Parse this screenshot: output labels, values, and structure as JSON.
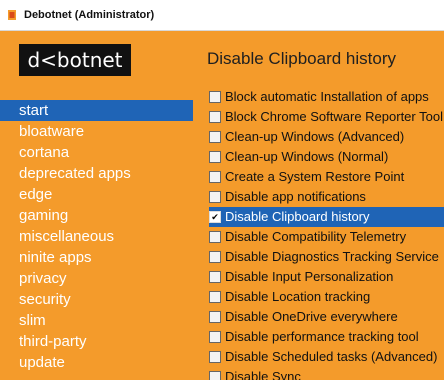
{
  "window": {
    "title": "Debotnet (Administrator)"
  },
  "sidebar": {
    "logo": "d<botnet",
    "items": [
      {
        "label": "start",
        "selected": true
      },
      {
        "label": "bloatware",
        "selected": false
      },
      {
        "label": "cortana",
        "selected": false
      },
      {
        "label": "deprecated apps",
        "selected": false
      },
      {
        "label": "edge",
        "selected": false
      },
      {
        "label": "gaming",
        "selected": false
      },
      {
        "label": "miscellaneous",
        "selected": false
      },
      {
        "label": "ninite apps",
        "selected": false
      },
      {
        "label": "privacy",
        "selected": false
      },
      {
        "label": "security",
        "selected": false
      },
      {
        "label": "slim",
        "selected": false
      },
      {
        "label": "third-party",
        "selected": false
      },
      {
        "label": "update",
        "selected": false
      }
    ]
  },
  "main": {
    "title": "Disable Clipboard history",
    "options": [
      {
        "label": "Block automatic Installation of apps",
        "checked": false,
        "selected": false
      },
      {
        "label": "Block Chrome Software Reporter Tool",
        "checked": false,
        "selected": false
      },
      {
        "label": "Clean-up Windows (Advanced)",
        "checked": false,
        "selected": false
      },
      {
        "label": "Clean-up Windows (Normal)",
        "checked": false,
        "selected": false
      },
      {
        "label": "Create a System Restore Point",
        "checked": false,
        "selected": false
      },
      {
        "label": "Disable app notifications",
        "checked": false,
        "selected": false
      },
      {
        "label": "Disable Clipboard history",
        "checked": true,
        "selected": true
      },
      {
        "label": "Disable Compatibility Telemetry",
        "checked": false,
        "selected": false
      },
      {
        "label": "Disable Diagnostics Tracking Service",
        "checked": false,
        "selected": false
      },
      {
        "label": "Disable Input Personalization",
        "checked": false,
        "selected": false
      },
      {
        "label": "Disable Location tracking",
        "checked": false,
        "selected": false
      },
      {
        "label": "Disable OneDrive everywhere",
        "checked": false,
        "selected": false
      },
      {
        "label": "Disable performance tracking tool",
        "checked": false,
        "selected": false
      },
      {
        "label": "Disable Scheduled tasks (Advanced)",
        "checked": false,
        "selected": false
      },
      {
        "label": "Disable Sync",
        "checked": false,
        "selected": false
      }
    ]
  },
  "colors": {
    "accent_orange": "#f49b2b",
    "selection_blue": "#1f64b6",
    "logo_bg": "#111111"
  }
}
